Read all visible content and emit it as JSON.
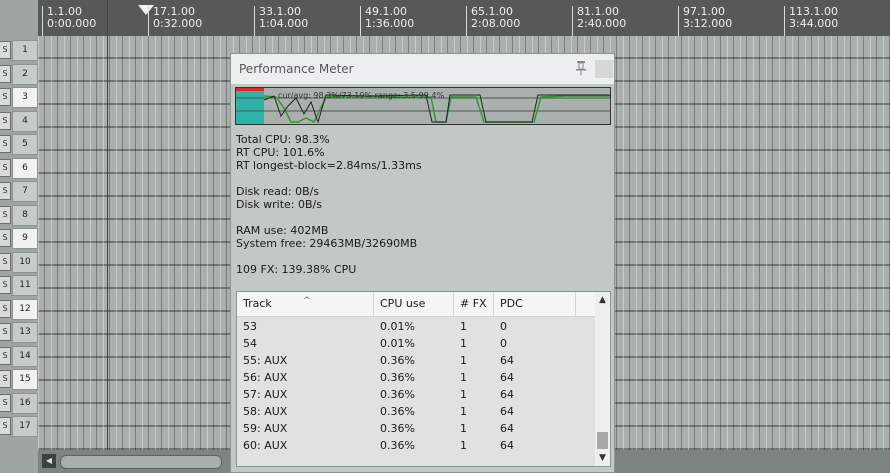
{
  "ruler": {
    "markers": [
      {
        "bar": "1.1.00",
        "time": "0:00.000"
      },
      {
        "bar": "17.1.00",
        "time": "0:32.000"
      },
      {
        "bar": "33.1.00",
        "time": "1:04.000"
      },
      {
        "bar": "49.1.00",
        "time": "1:36.000"
      },
      {
        "bar": "65.1.00",
        "time": "2:08.000"
      },
      {
        "bar": "81.1.00",
        "time": "2:40.000"
      },
      {
        "bar": "97.1.00",
        "time": "3:12.000"
      },
      {
        "bar": "113.1.00",
        "time": "3:44.000"
      }
    ]
  },
  "tracks": [
    {
      "num": "1",
      "btn": "S"
    },
    {
      "num": "2",
      "btn": "S"
    },
    {
      "num": "3",
      "btn": "S"
    },
    {
      "num": "4",
      "btn": "S"
    },
    {
      "num": "5",
      "btn": "S"
    },
    {
      "num": "6",
      "btn": "S"
    },
    {
      "num": "7",
      "btn": "S"
    },
    {
      "num": "8",
      "btn": "S"
    },
    {
      "num": "9",
      "btn": "S"
    },
    {
      "num": "10",
      "btn": "S"
    },
    {
      "num": "11",
      "btn": "S"
    },
    {
      "num": "12",
      "btn": "S"
    },
    {
      "num": "13",
      "btn": "S"
    },
    {
      "num": "14",
      "btn": "S"
    },
    {
      "num": "15",
      "btn": "S"
    },
    {
      "num": "16",
      "btn": "S"
    },
    {
      "num": "17",
      "btn": "S"
    }
  ],
  "perf": {
    "title": "Performance Meter",
    "graph_overlay": "cur/avg: 98.3%/73.19% range: 3.5-99.4%",
    "total_cpu": "Total CPU: 98.3%",
    "rt_cpu": "RT CPU: 101.6%",
    "rt_longest": "RT longest-block=2.84ms/1.33ms",
    "disk_read": "Disk read: 0B/s",
    "disk_write": "Disk write: 0B/s",
    "ram_use": "RAM use: 402MB",
    "system_free": "System free: 29463MB/32690MB",
    "fx_summary": "109 FX: 139.38% CPU",
    "table": {
      "headers": [
        "Track",
        "CPU use",
        "# FX",
        "PDC"
      ],
      "rows": [
        [
          "53",
          "0.01%",
          "1",
          "0"
        ],
        [
          "54",
          "0.01%",
          "1",
          "0"
        ],
        [
          "55: AUX",
          "0.36%",
          "1",
          "64"
        ],
        [
          "56: AUX",
          "0.36%",
          "1",
          "64"
        ],
        [
          "57: AUX",
          "0.36%",
          "1",
          "64"
        ],
        [
          "58: AUX",
          "0.36%",
          "1",
          "64"
        ],
        [
          "59: AUX",
          "0.36%",
          "1",
          "64"
        ],
        [
          "60: AUX",
          "0.36%",
          "1",
          "64"
        ]
      ]
    }
  },
  "colors": {
    "cursor_line": "#8a2a22",
    "graph_teal": "#2fb3a8",
    "graph_red": "#d92b2b",
    "graph_green": "#2f9a2f"
  },
  "icons": [
    "pin-icon",
    "play-marker-icon",
    "chevron-up-icon",
    "chevron-down-icon",
    "scroll-left-icon"
  ]
}
